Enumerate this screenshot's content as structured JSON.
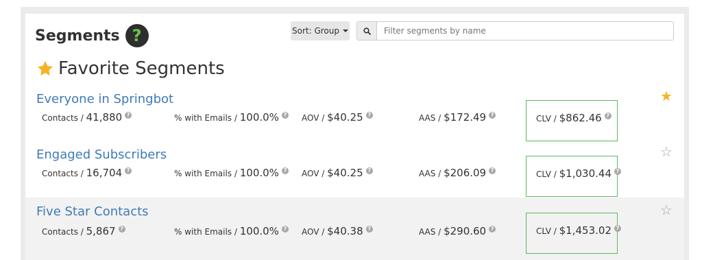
{
  "header": {
    "title": "Segments",
    "help_symbol": "?",
    "sort_label": "Sort: Group",
    "search_placeholder": "Filter segments by name"
  },
  "favorites": {
    "heading": "Favorite Segments"
  },
  "segments": [
    {
      "name": "Everyone in Springbot",
      "contacts_label": "Contacts /",
      "contacts": "41,880",
      "emails_label": "% with Emails /",
      "emails": "100.0%",
      "aov_label": "AOV /",
      "aov": "$40.25",
      "aas_label": "AAS /",
      "aas": "$172.49",
      "clv_label": "CLV /",
      "clv": "$862.46",
      "favorited": true
    },
    {
      "name": "Engaged Subscribers",
      "contacts_label": "Contacts /",
      "contacts": "16,704",
      "emails_label": "% with Emails /",
      "emails": "100.0%",
      "aov_label": "AOV /",
      "aov": "$40.25",
      "aas_label": "AAS /",
      "aas": "$206.09",
      "clv_label": "CLV /",
      "clv": "$1,030.44",
      "favorited": false
    },
    {
      "name": "Five Star Contacts",
      "contacts_label": "Contacts /",
      "contacts": "5,867",
      "emails_label": "% with Emails /",
      "emails": "100.0%",
      "aov_label": "AOV /",
      "aov": "$40.38",
      "aas_label": "AAS /",
      "aas": "$290.60",
      "clv_label": "CLV /",
      "clv": "$1,453.02",
      "favorited": false
    }
  ],
  "colors": {
    "link": "#3d7ab8",
    "accent_green": "#5cb85c",
    "star_gold": "#f5b324",
    "help_green": "#6cc04a"
  }
}
